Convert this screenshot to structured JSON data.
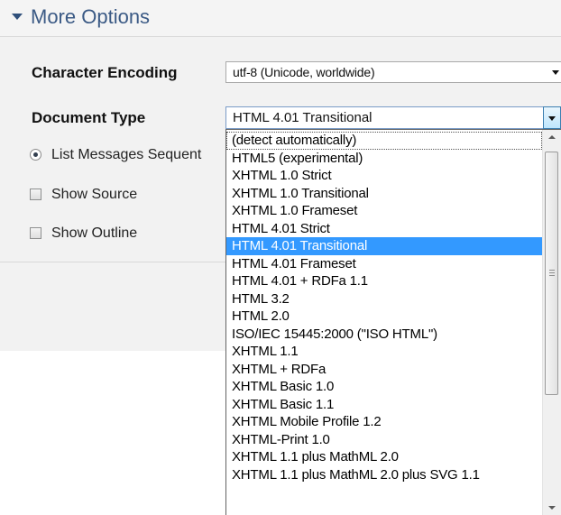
{
  "header": {
    "title": "More Options"
  },
  "form": {
    "character_encoding": {
      "label": "Character Encoding",
      "value": "utf-8 (Unicode, worldwide)"
    },
    "document_type": {
      "label": "Document Type",
      "value": "HTML 4.01 Transitional"
    },
    "list_messages": {
      "label": "List Messages Sequent",
      "selected": true
    },
    "show_source": {
      "label": "Show Source",
      "checked": false
    },
    "show_outline": {
      "label": "Show Outline",
      "checked": false
    }
  },
  "dropdown": {
    "selected_index": 6,
    "options": [
      "(detect automatically)",
      "HTML5 (experimental)",
      "XHTML 1.0 Strict",
      "XHTML 1.0 Transitional",
      "XHTML 1.0 Frameset",
      "HTML 4.01 Strict",
      "HTML 4.01 Transitional",
      "HTML 4.01 Frameset",
      "HTML 4.01 + RDFa 1.1",
      "HTML 3.2",
      "HTML 2.0",
      "ISO/IEC 15445:2000 (\"ISO HTML\")",
      "XHTML 1.1",
      "XHTML + RDFa",
      "XHTML Basic 1.0",
      "XHTML Basic 1.1",
      "XHTML Mobile Profile 1.2",
      "XHTML-Print 1.0",
      "XHTML 1.1 plus MathML 2.0",
      "XHTML 1.1 plus MathML 2.0 plus SVG 1.1"
    ]
  },
  "colors": {
    "header_title": "#3b5a85",
    "selection": "#3399ff",
    "panel": "#f2f2f2"
  },
  "icons": {
    "header": "triangle-down-icon",
    "select": "chevron-down-icon"
  }
}
